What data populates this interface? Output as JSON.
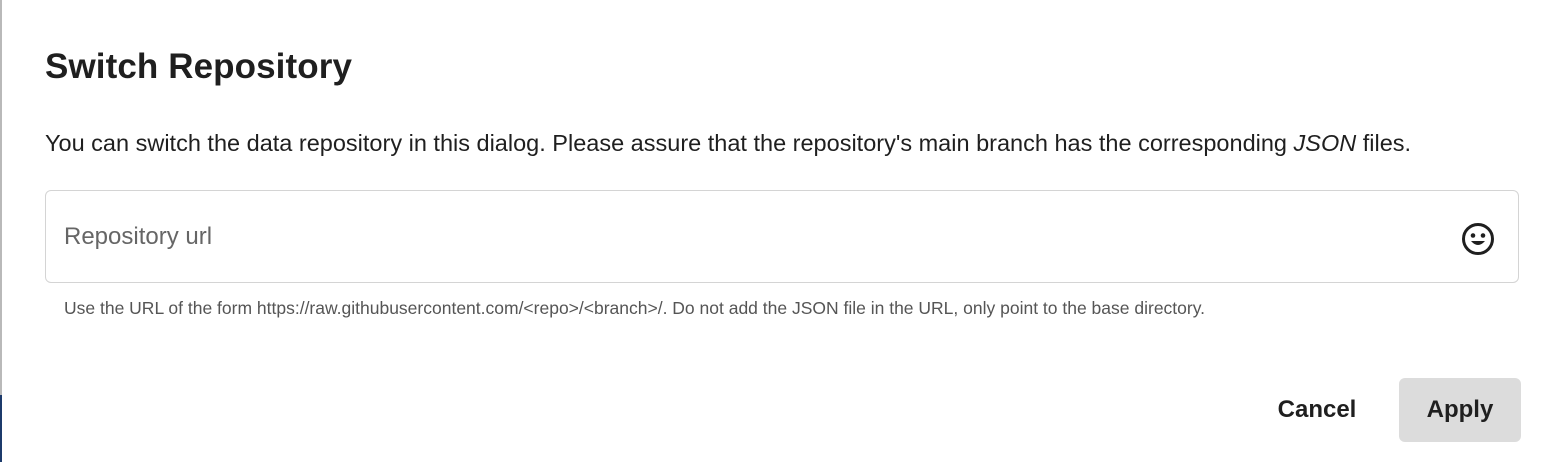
{
  "dialog": {
    "title": "Switch Repository",
    "description_before": "You can switch the data repository in this dialog. Please assure that the repository's main branch has the corresponding ",
    "description_emphasis": "JSON",
    "description_after": " files.",
    "field": {
      "value": "",
      "placeholder": "Repository url",
      "adornment_icon": "smiley-face-icon"
    },
    "helper_text": "Use the URL of the form https://raw.githubusercontent.com/<repo>/<branch>/. Do not add the JSON file in the URL, only point to the base directory.",
    "actions": {
      "cancel_label": "Cancel",
      "apply_label": "Apply"
    }
  },
  "colors": {
    "title_text": "#1f1f1f",
    "helper_text": "#555555",
    "field_border": "#d4d4d4",
    "apply_background": "#dcdcdc"
  }
}
